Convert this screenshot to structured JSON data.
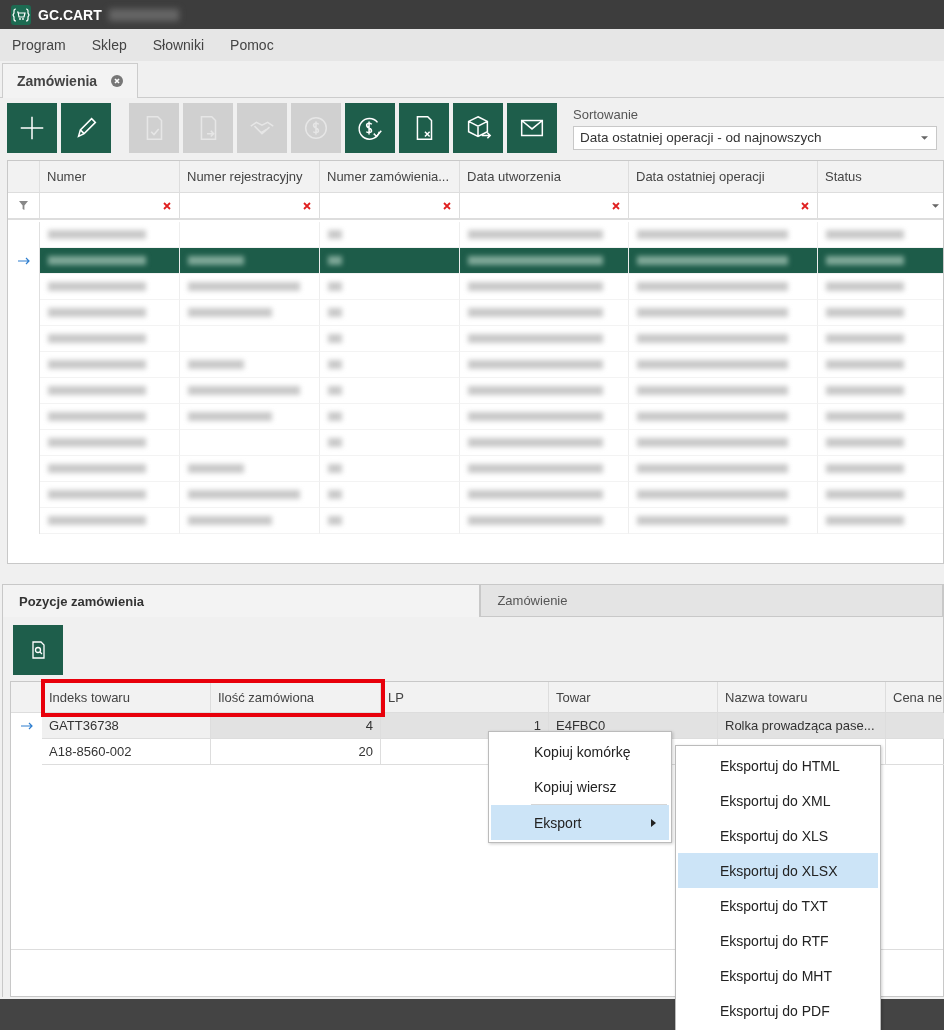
{
  "window": {
    "title": "GC.CART"
  },
  "menu_bar": [
    "Program",
    "Sklep",
    "Słowniki",
    "Pomoc"
  ],
  "document_tabs": [
    {
      "label": "Zamówienia"
    }
  ],
  "toolbar": [
    {
      "kind": "add",
      "disabled": false
    },
    {
      "kind": "edit",
      "disabled": false
    },
    {
      "kind": "doc-check",
      "disabled": true
    },
    {
      "kind": "doc-arrow",
      "disabled": true
    },
    {
      "kind": "handshake",
      "disabled": true
    },
    {
      "kind": "coin",
      "disabled": true
    },
    {
      "kind": "coin-check",
      "disabled": false
    },
    {
      "kind": "doc-cancel",
      "disabled": false
    },
    {
      "kind": "box-arrow",
      "disabled": false
    },
    {
      "kind": "mail",
      "disabled": false
    }
  ],
  "sorting": {
    "label": "Sortowanie",
    "value": "Data ostatniej operacji - od najnowszych"
  },
  "orders_table": {
    "columns": [
      {
        "label": "Numer",
        "kind": "text"
      },
      {
        "label": "Numer rejestracyjny",
        "kind": "text"
      },
      {
        "label": "Numer zamówienia...",
        "kind": "text"
      },
      {
        "label": "Data utworzenia",
        "kind": "text"
      },
      {
        "label": "Data ostatniej operacji",
        "kind": "text"
      },
      {
        "label": "Status",
        "kind": "dropdown"
      }
    ],
    "rows": [
      {
        "selected": false
      },
      {
        "selected": true
      },
      {
        "selected": false
      },
      {
        "selected": false
      },
      {
        "selected": false
      },
      {
        "selected": false
      },
      {
        "selected": false
      },
      {
        "selected": false
      },
      {
        "selected": false
      },
      {
        "selected": false
      },
      {
        "selected": false
      },
      {
        "selected": false
      }
    ]
  },
  "detail_tabs": [
    {
      "label": "Pozycje zamówienia",
      "selected": true
    },
    {
      "label": "Zamówienie",
      "selected": false
    }
  ],
  "items_table": {
    "columns": [
      "Indeks towaru",
      "Ilość zamówiona",
      "LP",
      "Towar",
      "Nazwa towaru",
      "Cena ne"
    ],
    "rows": [
      {
        "selected": true,
        "cells": [
          "GATT36738",
          "4",
          "1",
          "E4FBC0",
          "Rolka prowadząca pase...",
          ""
        ]
      },
      {
        "selected": false,
        "cells": [
          "A18-8560-002",
          "20",
          "",
          "",
          "",
          ""
        ]
      }
    ]
  },
  "context_menu": [
    {
      "label": "Kopiuj komórkę",
      "kind": "item",
      "selected": false
    },
    {
      "label": "Kopiuj wiersz",
      "kind": "item",
      "selected": false
    },
    {
      "label": "Eksport",
      "kind": "submenu",
      "selected": true
    }
  ],
  "export_submenu": [
    {
      "label": "Eksportuj do HTML",
      "selected": false
    },
    {
      "label": "Eksportuj do XML",
      "selected": false
    },
    {
      "label": "Eksportuj do XLS",
      "selected": false
    },
    {
      "label": "Eksportuj do XLSX",
      "selected": true
    },
    {
      "label": "Eksportuj do TXT",
      "selected": false
    },
    {
      "label": "Eksportuj do RTF",
      "selected": false
    },
    {
      "label": "Eksportuj do MHT",
      "selected": false
    },
    {
      "label": "Eksportuj do PDF",
      "selected": false
    }
  ]
}
